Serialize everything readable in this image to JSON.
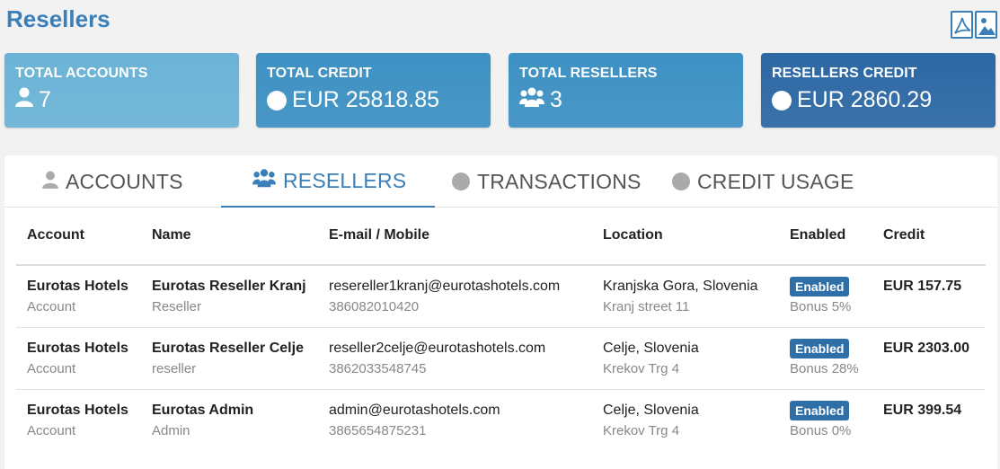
{
  "page": {
    "title": "Resellers"
  },
  "export": {
    "pdf_icon": "pdf-file-icon",
    "image_icon": "image-file-icon"
  },
  "cards": [
    {
      "title": "TOTAL ACCOUNTS",
      "icon": "user-icon",
      "value": "7",
      "color": "#6bb3d6"
    },
    {
      "title": "TOTAL CREDIT",
      "icon": "circle-icon",
      "value": "EUR 25818.85",
      "color": "#3d91c3"
    },
    {
      "title": "TOTAL RESELLERS",
      "icon": "users-icon",
      "value": "3",
      "color": "#3d91c3"
    },
    {
      "title": "RESELLERS CREDIT",
      "icon": "circle-icon",
      "value": "EUR 2860.29",
      "color": "#2d68a4"
    }
  ],
  "tabs": [
    {
      "label": "ACCOUNTS",
      "icon": "user-icon",
      "active": false
    },
    {
      "label": "RESELLERS",
      "icon": "users-icon",
      "active": true
    },
    {
      "label": "TRANSACTIONS",
      "icon": "circle-icon",
      "active": false
    },
    {
      "label": "CREDIT USAGE",
      "icon": "circle-icon",
      "active": false
    }
  ],
  "table": {
    "headers": [
      "Account",
      "Name",
      "E-mail / Mobile",
      "Location",
      "Enabled",
      "Credit"
    ],
    "rows": [
      {
        "account": "Eurotas Hotels",
        "account_type": "Account",
        "name": "Eurotas Reseller Kranj",
        "role": "Reseller",
        "email": "resereller1kranj@eurotashotels.com",
        "mobile": "386082010420",
        "location": "Kranjska Gora, Slovenia",
        "address": "Kranj street 11",
        "enabled": "Enabled",
        "bonus": "Bonus 5%",
        "credit": "EUR 157.75"
      },
      {
        "account": "Eurotas Hotels",
        "account_type": "Account",
        "name": "Eurotas Reseller Celje",
        "role": "reseller",
        "email": "reseller2celje@eurotashotels.com",
        "mobile": "3862033548745",
        "location": "Celje, Slovenia",
        "address": "Krekov Trg 4",
        "enabled": "Enabled",
        "bonus": "Bonus 28%",
        "credit": "EUR 2303.00"
      },
      {
        "account": "Eurotas Hotels",
        "account_type": "Account",
        "name": "Eurotas Admin",
        "role": "Admin",
        "email": "admin@eurotashotels.com",
        "mobile": "3865654875231",
        "location": "Celje, Slovenia",
        "address": "Krekov Trg 4",
        "enabled": "Enabled",
        "bonus": "Bonus 0%",
        "credit": "EUR 399.54"
      }
    ]
  }
}
